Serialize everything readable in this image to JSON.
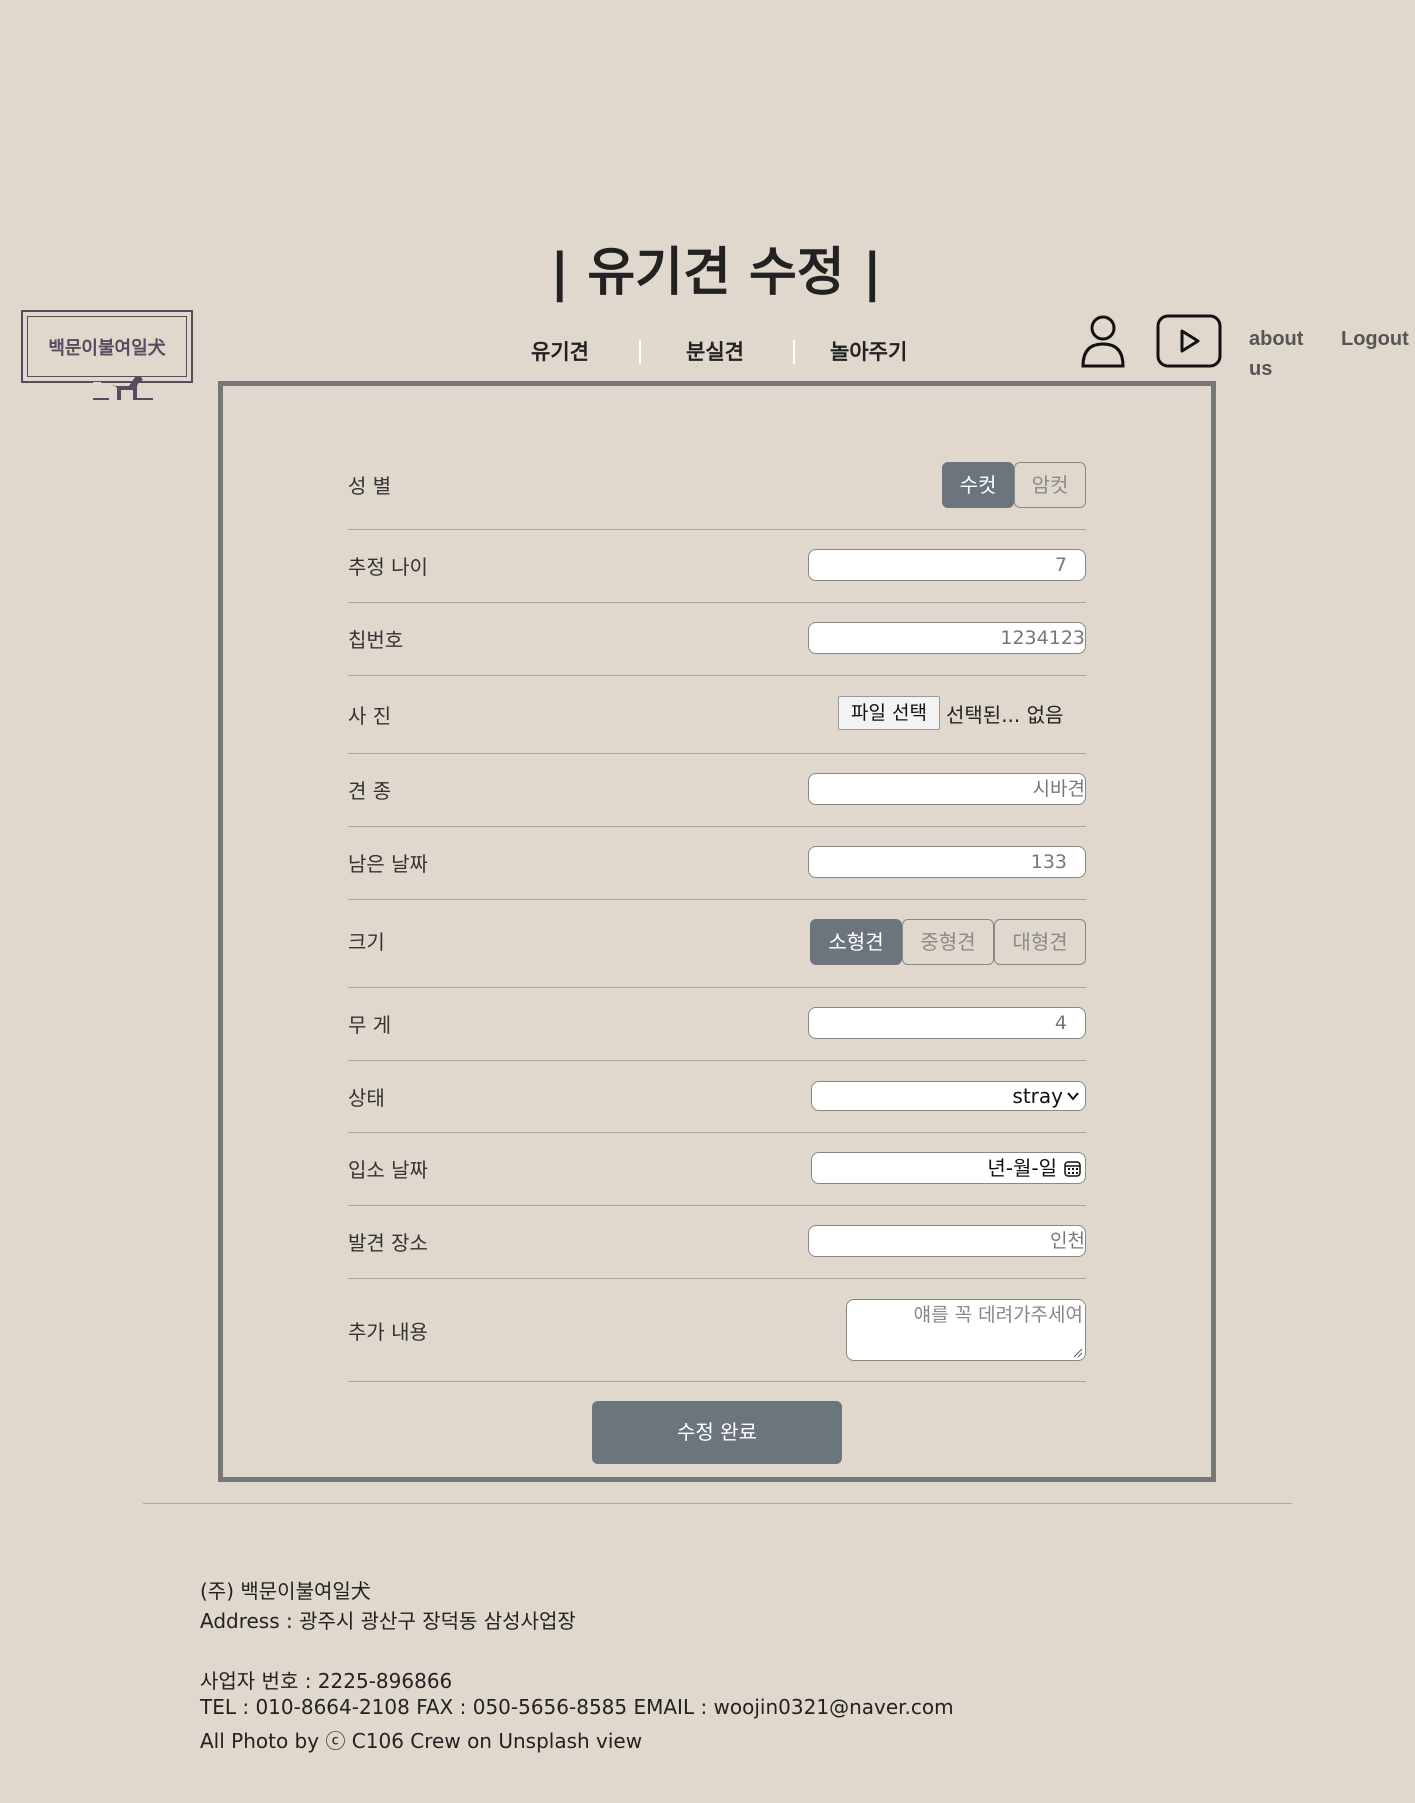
{
  "page": {
    "title": "| 유기견 수정 |"
  },
  "logo": {
    "text": "백문이불여일犬"
  },
  "nav": {
    "items": [
      {
        "label": "유기견"
      },
      {
        "label": "분실견"
      },
      {
        "label": "놀아주기"
      }
    ],
    "user_icon": "user-icon",
    "video_icon": "play-icon",
    "about_label_1": "about",
    "about_label_2": "us",
    "logout_label": "Logout"
  },
  "form": {
    "gender": {
      "label": "성 별",
      "options": [
        "수컷",
        "암컷"
      ],
      "selected": "수컷"
    },
    "age": {
      "label": "추정 나이",
      "value": "7"
    },
    "chip": {
      "label": "칩번호",
      "value": "1234123"
    },
    "photo": {
      "label": "사 진",
      "button": "파일 선택",
      "status": "선택된... 없음"
    },
    "breed": {
      "label": "견 종",
      "value": "시바견"
    },
    "days_left": {
      "label": "남은 날짜",
      "value": "133"
    },
    "size": {
      "label": "크기",
      "options": [
        "소형견",
        "중형견",
        "대형견"
      ],
      "selected": "소형견"
    },
    "weight": {
      "label": "무 게",
      "value": "4"
    },
    "status": {
      "label": "상태",
      "value": "stray"
    },
    "intake_date": {
      "label": "입소 날짜",
      "placeholder": "년-월-일"
    },
    "found_location": {
      "label": "발견 장소",
      "value": "인천"
    },
    "notes": {
      "label": "추가 내용",
      "value": "얘를 꼭 데려가주세여"
    },
    "submit_label": "수정 완료"
  },
  "footer": {
    "company": "(주) 백문이불여일犬",
    "address": "Address : 광주시 광산구 장덕동 삼성사업장",
    "business_number": "사업자 번호 : 2225-896866",
    "contact": "TEL : 010-8664-2108 FAX : 050-5656-8585 EMAIL : woojin0321@naver.com",
    "credit": "All Photo by ⓒ C106 Crew on Unsplash view"
  },
  "colors": {
    "background": "#e0d8cd",
    "accent": "#6c757d",
    "logo": "#5a4a60"
  }
}
